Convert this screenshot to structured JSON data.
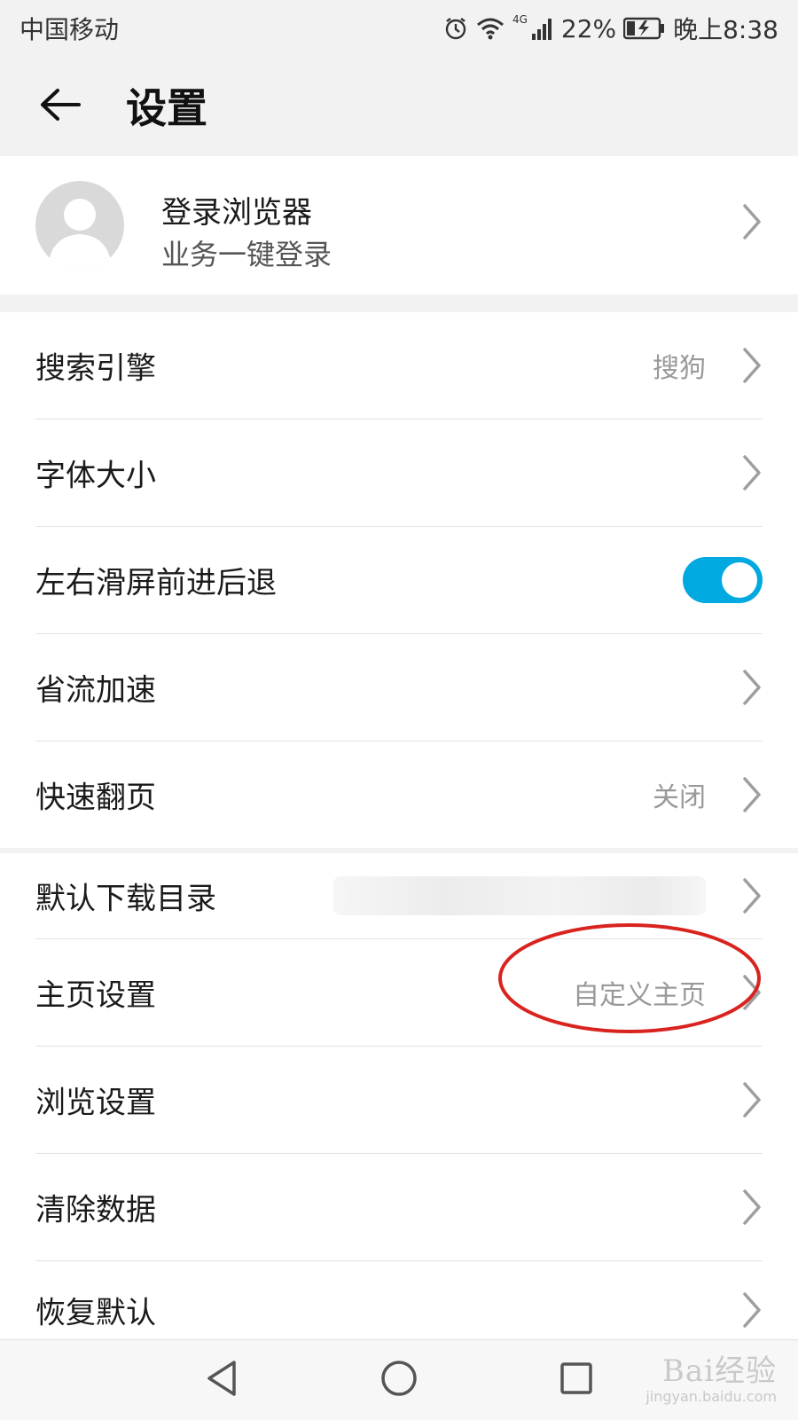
{
  "status_bar": {
    "carrier": "中国移动",
    "network": "4G",
    "battery": "22%",
    "time": "晚上8:38",
    "icons": [
      "alarm-icon",
      "wifi-icon",
      "signal-icon",
      "battery-charging-icon"
    ]
  },
  "header": {
    "title": "设置",
    "back_icon": "arrow-left-icon"
  },
  "profile": {
    "title": "登录浏览器",
    "subtitle": "业务一键登录",
    "avatar_icon": "default-avatar-icon"
  },
  "settings_group_1": [
    {
      "label": "搜索引擎",
      "value": "搜狗"
    },
    {
      "label": "字体大小",
      "value": ""
    },
    {
      "label": "左右滑屏前进后退",
      "toggle_on": true
    },
    {
      "label": "省流加速",
      "value": ""
    },
    {
      "label": "快速翻页",
      "value": "关闭"
    }
  ],
  "settings_group_2": [
    {
      "label": "默认下载目录",
      "value_blurred": true
    },
    {
      "label": "主页设置",
      "value": "自定义主页",
      "annotated": true
    },
    {
      "label": "浏览设置",
      "value": ""
    },
    {
      "label": "清除数据",
      "value": ""
    },
    {
      "label": "恢复默认",
      "value": ""
    }
  ],
  "nav_bar": {
    "icons": [
      "nav-back-triangle-icon",
      "nav-home-circle-icon",
      "nav-recent-square-icon"
    ]
  },
  "watermark": {
    "logo": "Bai经验",
    "url": "jingyan.baidu.com"
  },
  "colors": {
    "toggle_on": "#00a9e0",
    "annotation": "#d9231f",
    "background": "#f2f2f2"
  }
}
